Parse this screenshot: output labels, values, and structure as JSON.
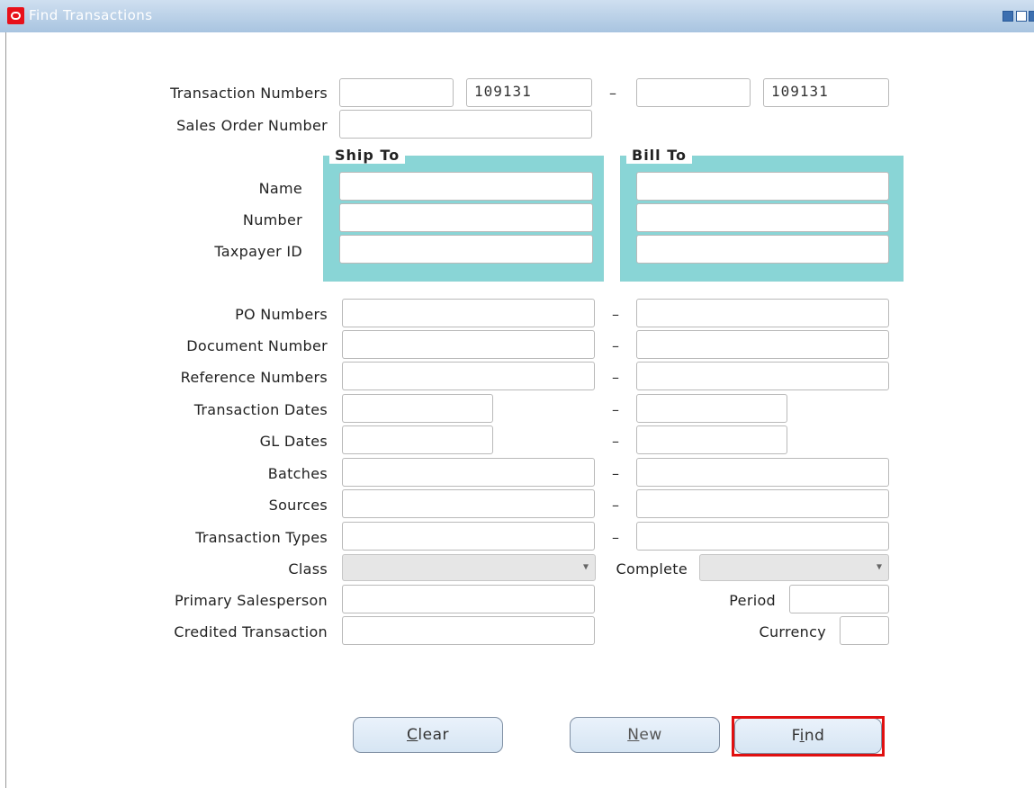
{
  "window": {
    "title": "Find Transactions"
  },
  "labels": {
    "transaction_numbers": "Transaction Numbers",
    "sales_order_number": "Sales Order Number",
    "name": "Name",
    "number": "Number",
    "taxpayer_id": "Taxpayer ID",
    "po_numbers": "PO Numbers",
    "document_number": "Document Number",
    "reference_numbers": "Reference Numbers",
    "transaction_dates": "Transaction Dates",
    "gl_dates": "GL Dates",
    "batches": "Batches",
    "sources": "Sources",
    "transaction_types": "Transaction Types",
    "class": "Class",
    "complete": "Complete",
    "primary_salesperson": "Primary Salesperson",
    "period": "Period",
    "credited_transaction": "Credited Transaction",
    "currency": "Currency"
  },
  "groups": {
    "ship_to": "Ship To",
    "bill_to": "Bill To"
  },
  "fields": {
    "transaction_numbers_from_prefix": "",
    "transaction_numbers_from": "109131",
    "transaction_numbers_to_prefix": "",
    "transaction_numbers_to": "109131"
  },
  "separator": "–",
  "buttons": {
    "clear_prefix": "",
    "clear_mnemonic": "C",
    "clear_rest": "lear",
    "new_prefix": "",
    "new_mnemonic": "N",
    "new_rest": "ew",
    "find_prefix": "F",
    "find_mnemonic": "i",
    "find_rest": "nd"
  },
  "colors": {
    "group_fill": "#89d5d6",
    "highlight": "#e01010",
    "titlebar": "#a8c4e0"
  }
}
